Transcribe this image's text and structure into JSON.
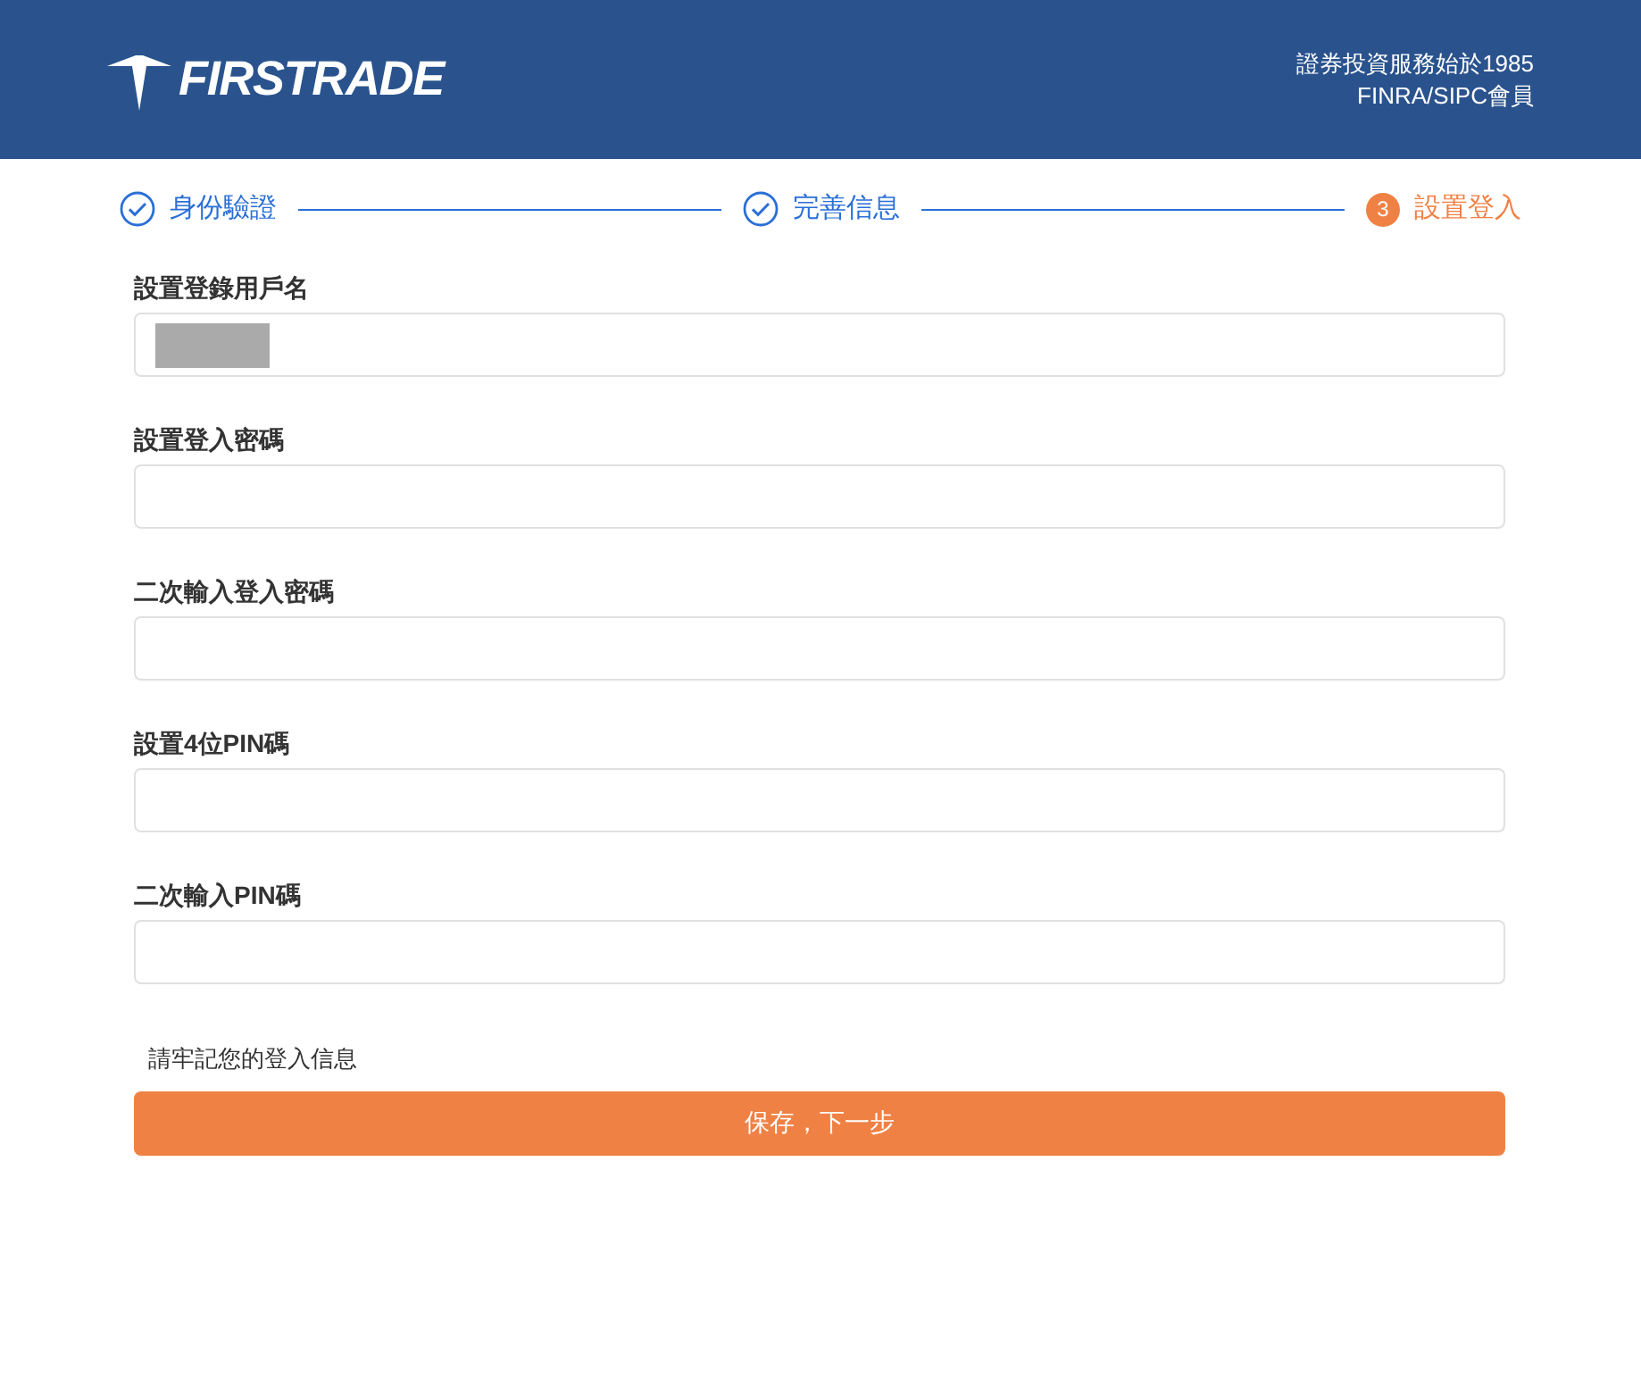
{
  "header": {
    "logo_text": "FIRSTRADE",
    "tagline": [
      "證券投資服務始於1985",
      "FINRA/SIPC會員"
    ]
  },
  "steps": [
    {
      "label": "身份驗證",
      "completed": true
    },
    {
      "label": "完善信息",
      "completed": true
    },
    {
      "label": "設置登入",
      "completed": false,
      "number": "3"
    }
  ],
  "fields": [
    {
      "label": "設置登錄用戶名",
      "redacted": true
    },
    {
      "label": "設置登入密碼",
      "redacted": false
    },
    {
      "label": "二次輸入登入密碼",
      "redacted": false
    },
    {
      "label": "設置4位PIN碼",
      "redacted": false
    },
    {
      "label": "二次輸入PIN碼",
      "redacted": false
    }
  ],
  "note": "請牢記您的登入信息",
  "submit_button": "保存，下一步"
}
